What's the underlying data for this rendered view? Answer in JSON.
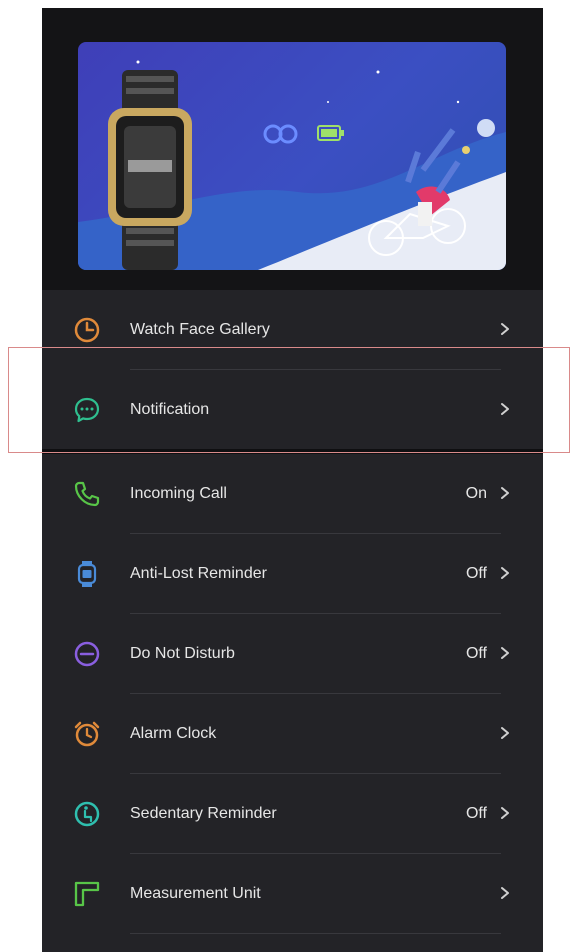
{
  "menu": {
    "items": [
      {
        "label": "Watch Face Gallery",
        "value": "",
        "icon": "watch-face-icon",
        "color": "#e08a3a"
      },
      {
        "label": "Notification",
        "value": "",
        "icon": "chat-bubble-icon",
        "color": "#2fbf8f"
      },
      {
        "label": "Incoming Call",
        "value": "On",
        "icon": "phone-icon",
        "color": "#58c548"
      },
      {
        "label": "Anti-Lost Reminder",
        "value": "Off",
        "icon": "watch-device-icon",
        "color": "#4a8bd8"
      },
      {
        "label": "Do Not Disturb",
        "value": "Off",
        "icon": "minus-circle-icon",
        "color": "#8a5fe0"
      },
      {
        "label": "Alarm Clock",
        "value": "",
        "icon": "alarm-clock-icon",
        "color": "#e08a3a"
      },
      {
        "label": "Sedentary Reminder",
        "value": "Off",
        "icon": "sedentary-icon",
        "color": "#2fbfaf"
      },
      {
        "label": "Measurement Unit",
        "value": "",
        "icon": "ruler-icon",
        "color": "#58c548"
      }
    ]
  },
  "colors": {
    "background": "#141416",
    "menu_background": "#232327",
    "text": "#e6e6e6",
    "highlight_border": "#d98a8a"
  }
}
